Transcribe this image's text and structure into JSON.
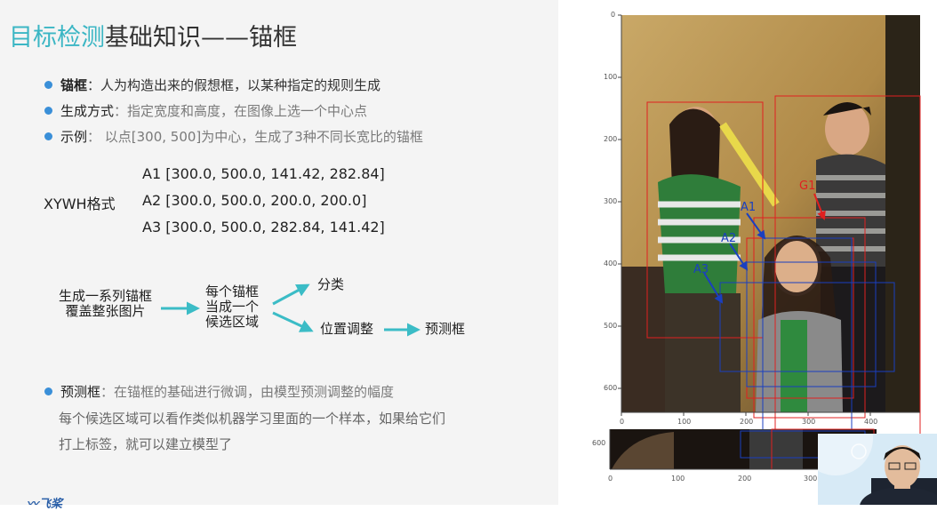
{
  "slide": {
    "title_accent": "目标检测",
    "title_rest": "基础知识——锚框",
    "bullets": [
      {
        "key": "锚框",
        "text": "：人为构造出来的假想框，以某种指定的规则生成"
      },
      {
        "key": "生成方式",
        "text": "：指定宽度和高度，在图像上选一个中心点"
      },
      {
        "key": "示例",
        "text": "：  以点[300, 500]为中心，生成了3种不同长宽比的锚框"
      }
    ],
    "xywh_label": "XYWH格式",
    "anchors": [
      "A1 [300.0, 500.0, 141.42, 282.84]",
      "A2 [300.0, 500.0, 200.0, 200.0]",
      "A3 [300.0, 500.0, 282.84, 141.42]"
    ],
    "flow": {
      "step1_line1": "生成一系列锚框",
      "step1_line2": "覆盖整张图片",
      "step2_line1": "每个锚框",
      "step2_line2": "当成一个",
      "step2_line3": "候选区域",
      "branch_top": "分类",
      "branch_bottom": "位置调整",
      "result": "预测框"
    },
    "pred_key": "预测框",
    "pred_text": "：在锚框的基础进行微调，由模型预测调整的幅度",
    "pred_note1": "每个候选区域可以看作类似机器学习里面的一个样本，如果给它们",
    "pred_note2": "打上标签，就可以建立模型了",
    "logo_text": "飞桨"
  },
  "figure": {
    "y_ticks": [
      "0",
      "100",
      "200",
      "300",
      "400",
      "500",
      "600"
    ],
    "x_ticks": [
      "0",
      "100",
      "200",
      "300",
      "400"
    ],
    "strip_y_tick": "600",
    "strip_x_ticks": [
      "0",
      "100",
      "200",
      "300"
    ],
    "labels": {
      "g1": "G1",
      "a1": "A1",
      "a2": "A2",
      "a3": "A3"
    },
    "colors": {
      "accent": "#3bb6c4",
      "bullet": "#3a8fd8",
      "arrow": "#3bbcc6",
      "box_red": "#e02020",
      "box_blue": "#1a3fc0"
    }
  }
}
